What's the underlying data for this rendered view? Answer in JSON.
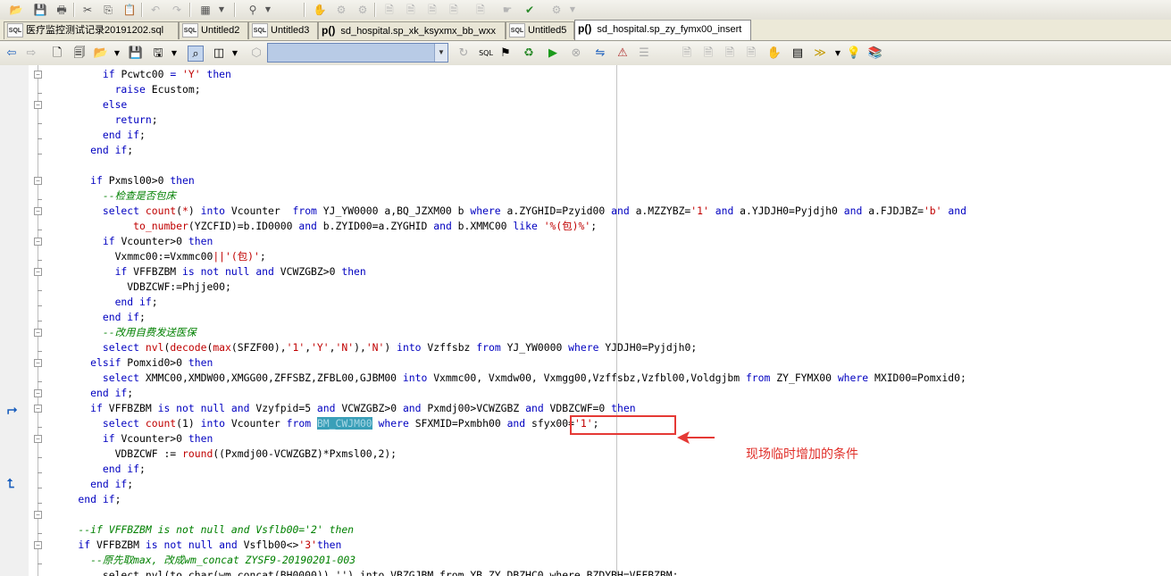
{
  "tabs": [
    {
      "label": "医疗监控测试记录20191202.sql",
      "type": "sql"
    },
    {
      "label": "Untitled2",
      "type": "sql"
    },
    {
      "label": "Untitled3",
      "type": "sql"
    },
    {
      "label": "sd_hospital.sp_xk_ksyxmx_bb_wxx",
      "type": "proc"
    },
    {
      "label": "Untitled5",
      "type": "sql"
    },
    {
      "label": "sd_hospital.sp_zy_fymx00_insert",
      "type": "proc",
      "active": true
    }
  ],
  "tab_icons": {
    "sql": "SQL",
    "proc": "p()"
  },
  "annotation": {
    "text": "现场临时增加的条件",
    "color": "#e0302a"
  },
  "code": [
    [
      [
        "kw",
        "        if "
      ],
      [
        "",
        "Pcwtc00 "
      ],
      [
        "kw",
        "= "
      ],
      [
        "str",
        "'Y' "
      ],
      [
        "kw",
        "then"
      ]
    ],
    [
      [
        "kw",
        "          raise "
      ],
      [
        "",
        "Ecustom;"
      ]
    ],
    [
      [
        "kw",
        "        else"
      ]
    ],
    [
      [
        "kw",
        "          return"
      ],
      [
        "",
        ";"
      ]
    ],
    [
      [
        "kw",
        "        end if"
      ],
      [
        "",
        ";"
      ]
    ],
    [
      [
        "kw",
        "      end if"
      ],
      [
        "",
        ";"
      ]
    ],
    [
      [
        "",
        ""
      ]
    ],
    [
      [
        "kw",
        "      if "
      ],
      [
        "",
        "Pxmsl00>0 "
      ],
      [
        "kw",
        "then"
      ]
    ],
    [
      [
        "cmt",
        "        --检查是否包床"
      ]
    ],
    [
      [
        "kw",
        "        select "
      ],
      [
        "fn",
        "count"
      ],
      [
        "",
        "("
      ],
      [
        "str",
        "*"
      ],
      [
        "",
        ") "
      ],
      [
        "kw",
        "into "
      ],
      [
        "",
        "Vcounter  "
      ],
      [
        "kw",
        "from "
      ],
      [
        "",
        "YJ_YW0000 a,BQ_JZXM00 b "
      ],
      [
        "kw",
        "where "
      ],
      [
        "",
        "a.ZYGHID=Pzyid00 "
      ],
      [
        "kw",
        "and "
      ],
      [
        "",
        "a.MZZYBZ="
      ],
      [
        "str",
        "'1' "
      ],
      [
        "kw",
        "and "
      ],
      [
        "",
        "a.YJDJH0=Pyjdjh0 "
      ],
      [
        "kw",
        "and "
      ],
      [
        "",
        "a.FJDJBZ="
      ],
      [
        "str",
        "'b' "
      ],
      [
        "kw",
        "and"
      ]
    ],
    [
      [
        "",
        "             "
      ],
      [
        "fn",
        "to_number"
      ],
      [
        "",
        "(YZCFID)=b.ID0000 "
      ],
      [
        "kw",
        "and "
      ],
      [
        "",
        "b.ZYID00=a.ZYGHID "
      ],
      [
        "kw",
        "and "
      ],
      [
        "",
        "b.XMMC00 "
      ],
      [
        "kw",
        "like "
      ],
      [
        "str",
        "'%(包)%'"
      ],
      [
        "",
        ";"
      ]
    ],
    [
      [
        "kw",
        "        if "
      ],
      [
        "",
        "Vcounter>0 "
      ],
      [
        "kw",
        "then"
      ]
    ],
    [
      [
        "",
        "          Vxmmc00:=Vxmmc00"
      ],
      [
        "str",
        "||'(包)'"
      ],
      [
        "",
        ";"
      ]
    ],
    [
      [
        "kw",
        "          if "
      ],
      [
        "",
        "VFFBZBM "
      ],
      [
        "kw",
        "is not null and "
      ],
      [
        "",
        "VCWZGBZ>0 "
      ],
      [
        "kw",
        "then"
      ]
    ],
    [
      [
        "",
        "            VDBZCWF:=Phjje00;"
      ]
    ],
    [
      [
        "kw",
        "          end if"
      ],
      [
        "",
        ";"
      ]
    ],
    [
      [
        "kw",
        "        end if"
      ],
      [
        "",
        ";"
      ]
    ],
    [
      [
        "cmt",
        "        --改用自费发送医保"
      ]
    ],
    [
      [
        "kw",
        "        select "
      ],
      [
        "fn",
        "nvl"
      ],
      [
        "",
        "("
      ],
      [
        "fn",
        "decode"
      ],
      [
        "",
        "("
      ],
      [
        "fn",
        "max"
      ],
      [
        "",
        "(SFZF00),"
      ],
      [
        "str",
        "'1'"
      ],
      [
        "",
        ","
      ],
      [
        "str",
        "'Y'"
      ],
      [
        "",
        ","
      ],
      [
        "str",
        "'N'"
      ],
      [
        "",
        "),"
      ],
      [
        "str",
        "'N'"
      ],
      [
        "",
        ") "
      ],
      [
        "kw",
        "into "
      ],
      [
        "",
        "Vzffsbz "
      ],
      [
        "kw",
        "from "
      ],
      [
        "",
        "YJ_YW0000 "
      ],
      [
        "kw",
        "where "
      ],
      [
        "",
        "YJDJH0=Pyjdjh0;"
      ]
    ],
    [
      [
        "kw",
        "      elsif "
      ],
      [
        "",
        "Pomxid0>0 "
      ],
      [
        "kw",
        "then"
      ]
    ],
    [
      [
        "kw",
        "        select "
      ],
      [
        "",
        "XMMC00,XMDW00,XMGG00,ZFFSBZ,ZFBL00,GJBM00 "
      ],
      [
        "kw",
        "into "
      ],
      [
        "",
        "Vxmmc00, Vxmdw00, Vxmgg00,Vzffsbz,Vzfbl00,Voldgjbm "
      ],
      [
        "kw",
        "from "
      ],
      [
        "",
        "ZY_FYMX00 "
      ],
      [
        "kw",
        "where "
      ],
      [
        "",
        "MXID00=Pomxid0;"
      ]
    ],
    [
      [
        "kw",
        "      end if"
      ],
      [
        "",
        ";"
      ]
    ],
    [
      [
        "kw",
        "      if "
      ],
      [
        "",
        "VFFBZBM "
      ],
      [
        "kw",
        "is not null and "
      ],
      [
        "",
        "Vzyfpid=5 "
      ],
      [
        "kw",
        "and "
      ],
      [
        "",
        "VCWZGBZ>0 "
      ],
      [
        "kw",
        "and "
      ],
      [
        "",
        "Pxmdj00>VCWZGBZ "
      ],
      [
        "kw",
        "and "
      ],
      [
        "",
        "VDBZCWF=0 "
      ],
      [
        "kw",
        "then"
      ]
    ],
    [
      [
        "kw",
        "        select "
      ],
      [
        "fn",
        "count"
      ],
      [
        "",
        "(1) "
      ],
      [
        "kw",
        "into "
      ],
      [
        "",
        "Vcounter "
      ],
      [
        "kw",
        "from "
      ],
      [
        "sel",
        "BM_CWJM00"
      ],
      [
        "",
        ""
      ],
      [
        "kw",
        " where "
      ],
      [
        "",
        "SFXMID=Pxmbh00 "
      ],
      [
        "kw",
        "and "
      ],
      [
        "",
        "sfyx00="
      ],
      [
        "str",
        "'1'"
      ],
      [
        "",
        ";"
      ]
    ],
    [
      [
        "kw",
        "        if "
      ],
      [
        "",
        "Vcounter>0 "
      ],
      [
        "kw",
        "then"
      ]
    ],
    [
      [
        "",
        "          VDBZCWF := "
      ],
      [
        "fn",
        "round"
      ],
      [
        "",
        "((Pxmdj00-VCWZGBZ)*Pxmsl00,2);"
      ]
    ],
    [
      [
        "kw",
        "        end if"
      ],
      [
        "",
        ";"
      ]
    ],
    [
      [
        "kw",
        "      end if"
      ],
      [
        "",
        ";"
      ]
    ],
    [
      [
        "kw",
        "    end if"
      ],
      [
        "",
        ";"
      ]
    ],
    [
      [
        "",
        ""
      ]
    ],
    [
      [
        "cmt",
        "    --if VFFBZBM is not null and Vsflb00='2' then"
      ]
    ],
    [
      [
        "kw",
        "    if "
      ],
      [
        "",
        "VFFBZBM "
      ],
      [
        "kw",
        "is not null and "
      ],
      [
        "",
        "Vsflb00<>"
      ],
      [
        "str",
        "'3'"
      ],
      [
        "kw",
        "then"
      ]
    ],
    [
      [
        "cmt",
        "      --原先取max, 改成wm_concat ZYSF9-20190201-003"
      ]
    ],
    [
      [
        "",
        "        select nvl(to_char(wm_concat(BH0000)),'') into VBZGJBM from YB_ZY_DBZHC0 where BZDYBH=VFFBZBM;"
      ]
    ]
  ]
}
